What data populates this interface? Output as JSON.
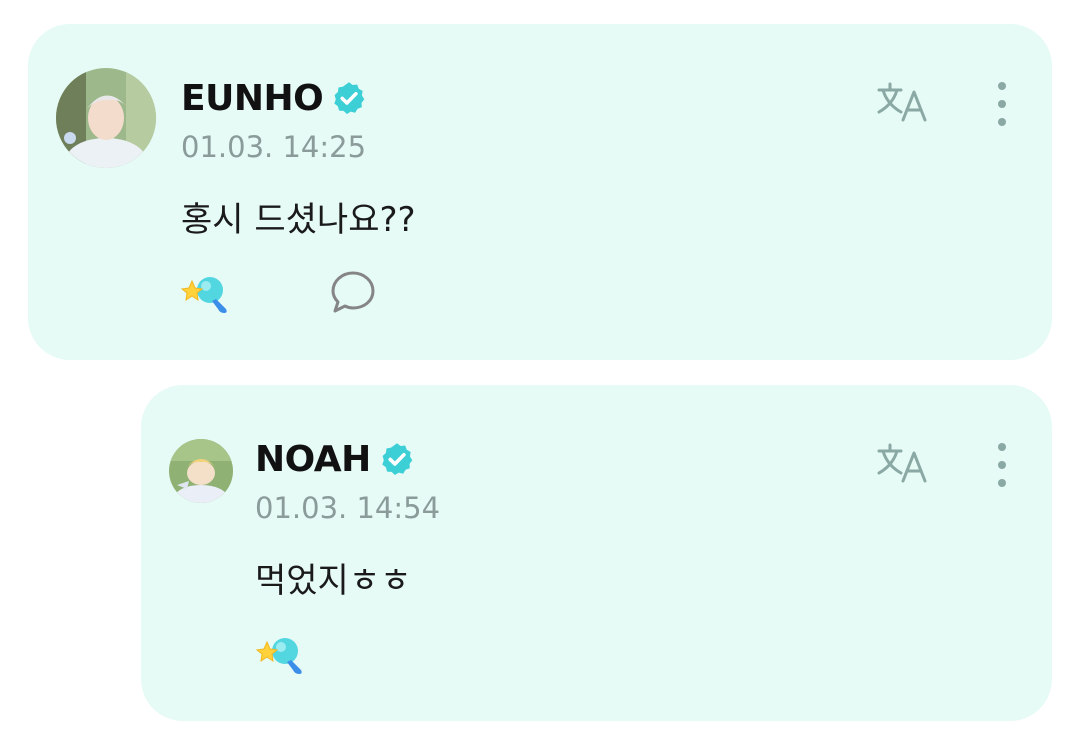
{
  "posts": [
    {
      "author": "EUNHO",
      "verified": true,
      "timestamp": "01.03. 14:25",
      "message": "홍시 드셨나요??",
      "avatar_icon": "user-avatar-photo"
    }
  ],
  "replies": [
    {
      "author": "NOAH",
      "verified": true,
      "timestamp": "01.03. 14:54",
      "message": "먹었지ㅎㅎ",
      "avatar_icon": "user-avatar-photo"
    }
  ],
  "icons": {
    "verified": "verified-check-icon",
    "translate": "translate-icon",
    "more": "more-vertical-icon",
    "reaction": "star-light-stick-icon",
    "comment": "comment-bubble-icon"
  },
  "colors": {
    "card_background": "#e6faf6",
    "verified_badge": "#3ccfd6",
    "icon_gray_green": "#8aa8a4",
    "timestamp": "#8a9b99"
  }
}
